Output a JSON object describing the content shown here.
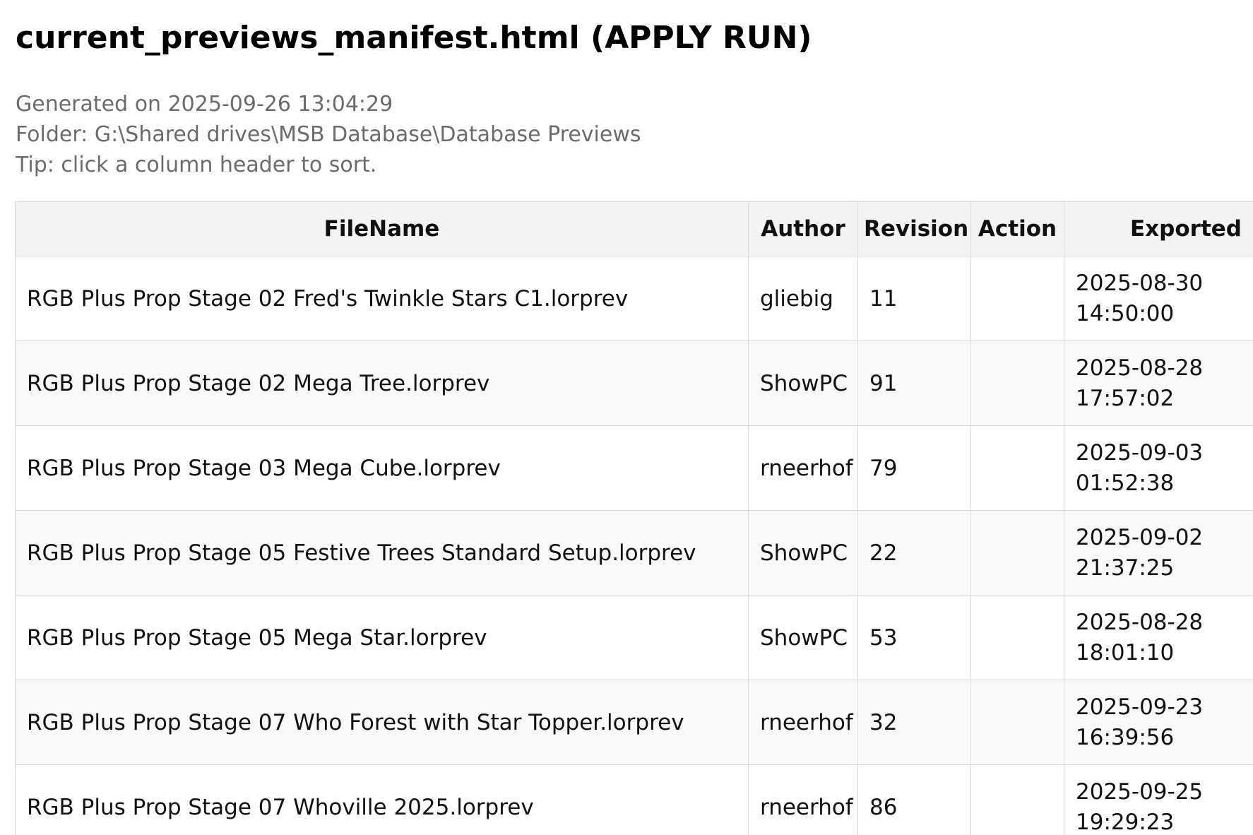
{
  "page": {
    "title": "current_previews_manifest.html (APPLY RUN)",
    "generated": "Generated on 2025-09-26 13:04:29",
    "folder": "Folder: G:\\Shared drives\\MSB Database\\Database Previews",
    "tip": "Tip: click a column header to sort."
  },
  "table": {
    "headers": {
      "filename": "FileName",
      "author": "Author",
      "revision": "Revision",
      "action": "Action",
      "exported": "Exported"
    },
    "rows": [
      {
        "filename": "RGB Plus Prop Stage 02 Fred's Twinkle Stars C1.lorprev",
        "author": "gliebig",
        "revision": "11",
        "action": "",
        "exported_date": "2025-08-30",
        "exported_time": "14:50:00"
      },
      {
        "filename": "RGB Plus Prop Stage 02 Mega Tree.lorprev",
        "author": "ShowPC",
        "revision": "91",
        "action": "",
        "exported_date": "2025-08-28",
        "exported_time": "17:57:02"
      },
      {
        "filename": "RGB Plus Prop Stage 03 Mega Cube.lorprev",
        "author": "rneerhof",
        "revision": "79",
        "action": "",
        "exported_date": "2025-09-03",
        "exported_time": "01:52:38"
      },
      {
        "filename": "RGB Plus Prop Stage 05 Festive Trees Standard Setup.lorprev",
        "author": "ShowPC",
        "revision": "22",
        "action": "",
        "exported_date": "2025-09-02",
        "exported_time": "21:37:25"
      },
      {
        "filename": "RGB Plus Prop Stage 05 Mega Star.lorprev",
        "author": "ShowPC",
        "revision": "53",
        "action": "",
        "exported_date": "2025-08-28",
        "exported_time": "18:01:10"
      },
      {
        "filename": "RGB Plus Prop Stage 07 Who Forest with Star Topper.lorprev",
        "author": "rneerhof",
        "revision": "32",
        "action": "",
        "exported_date": "2025-09-23",
        "exported_time": "16:39:56"
      },
      {
        "filename": "RGB Plus Prop Stage 07 Whoville 2025.lorprev",
        "author": "rneerhof",
        "revision": "86",
        "action": "",
        "exported_date": "2025-09-25",
        "exported_time": "19:29:23"
      }
    ]
  }
}
